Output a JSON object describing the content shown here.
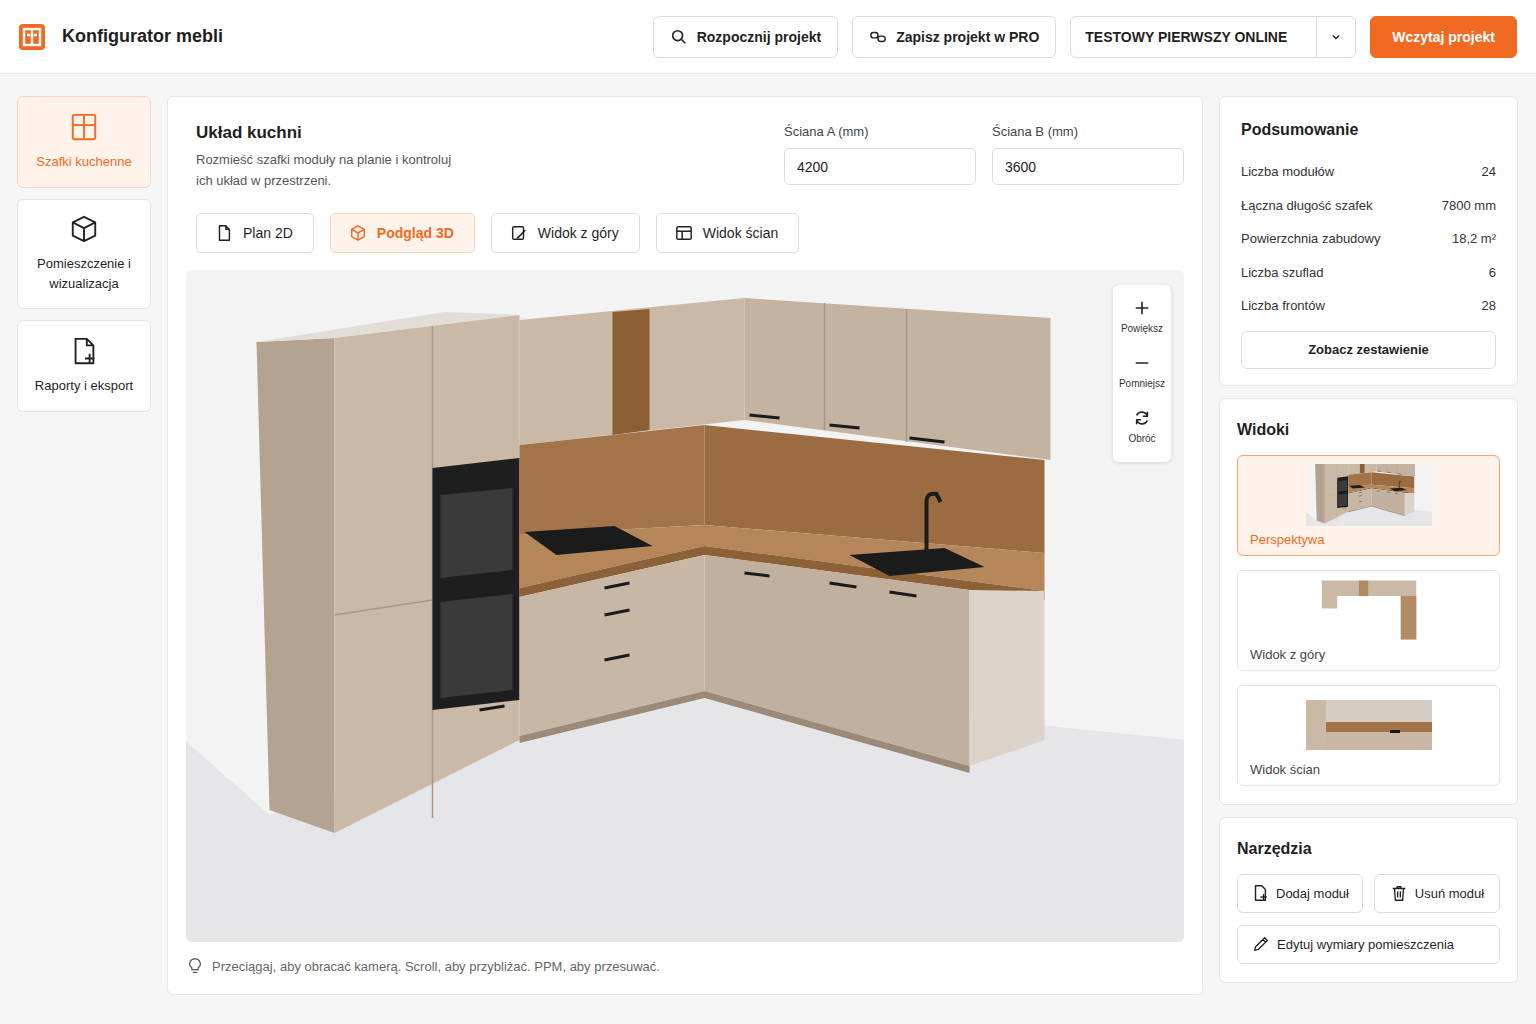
{
  "header": {
    "title": "Konfigurator mebli",
    "start_button": "Rozpocznij projekt",
    "save_pro_button": "Zapisz projekt w PRO",
    "project_select": {
      "value": "TESTOWY PIERWSZY ONLINE"
    },
    "load_button": "Wczytaj projekt"
  },
  "sidebar": {
    "items": [
      {
        "label": "Szafki kuchenne",
        "selected": true
      },
      {
        "label": "Pomieszczenie i wizualizacja",
        "selected": false
      },
      {
        "label": "Raporty i eksport",
        "selected": false
      }
    ]
  },
  "layout": {
    "title": "Układ kuchni",
    "description": "Rozmieść szafki moduły na planie i kontroluj ich układ w przestrzeni.",
    "walls": [
      {
        "label": "Ściana A (mm)",
        "value": "4200"
      },
      {
        "label": "Ściana B (mm)",
        "value": "3600"
      }
    ],
    "tabs": [
      {
        "label": "Plan 2D",
        "selected": false
      },
      {
        "label": "Podgląd 3D",
        "selected": true
      },
      {
        "label": "Widok z góry",
        "selected": false
      },
      {
        "label": "Widok ścian",
        "selected": false
      }
    ],
    "viewport_controls": [
      "Powiększ",
      "Pomniejsz",
      "Obróć"
    ],
    "hint": "Przeciągaj, aby obracać kamerą. Scroll, aby przybliżać. PPM, aby przesuwać."
  },
  "summary": {
    "title": "Podsumowanie",
    "rows": [
      {
        "label": "Liczba modułów",
        "value": "24"
      },
      {
        "label": "Łączna długość szafek",
        "value": "7800 mm"
      },
      {
        "label": "Powierzchnia zabudowy",
        "value": "18,2 m²"
      },
      {
        "label": "Liczba szuflad",
        "value": "6"
      },
      {
        "label": "Liczba frontów",
        "value": "28"
      }
    ],
    "button": "Zobacz zestawienie"
  },
  "views": {
    "title": "Widoki",
    "items": [
      {
        "label": "Perspektywa",
        "selected": true
      },
      {
        "label": "Widok z góry",
        "selected": false
      },
      {
        "label": "Widok ścian",
        "selected": false
      }
    ]
  },
  "tools": {
    "title": "Narzędzia",
    "add_button": "Dodaj moduł",
    "remove_button": "Usuń moduł",
    "edit_button": "Edytuj wymiary pomieszczenia"
  }
}
